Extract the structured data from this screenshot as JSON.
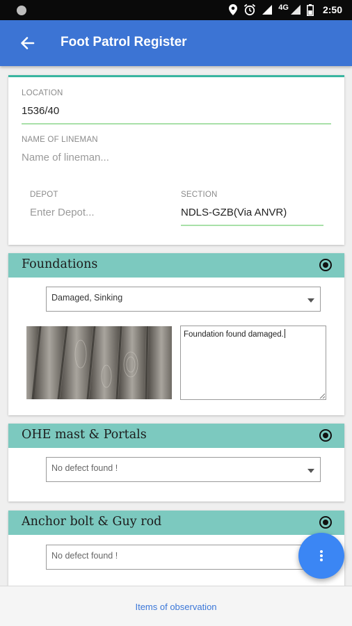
{
  "status_bar": {
    "network": "4G",
    "time": "2:50"
  },
  "header": {
    "title": "Foot Patrol Register"
  },
  "form": {
    "location": {
      "label": "LOCATION",
      "value": "1536/40"
    },
    "lineman": {
      "label": "NAME OF LINEMAN",
      "placeholder": "Name of lineman..."
    },
    "depot": {
      "label": "DEPOT",
      "placeholder": "Enter Depot..."
    },
    "section": {
      "label": "SECTION",
      "value": "NDLS-GZB(Via ANVR)"
    }
  },
  "sections": [
    {
      "title": "Foundations",
      "selected": "Damaged, Sinking",
      "remarks": "Foundation found damaged."
    },
    {
      "title": "OHE mast & Portals",
      "selected": "No defect found !"
    },
    {
      "title": "Anchor bolt & Guy rod",
      "selected": "No defect found !"
    }
  ],
  "bottom": {
    "label": "Items of observation"
  },
  "colors": {
    "appbar": "#3c74d4",
    "section_header": "#7cc9bf",
    "fab": "#3b86f4",
    "accent_line": "#a8e0a8"
  },
  "icons": [
    "back-arrow-icon",
    "radio-selected-icon",
    "dropdown-arrow-icon",
    "more-vert-icon",
    "location-icon",
    "alarm-icon",
    "signal-icon",
    "battery-icon"
  ]
}
